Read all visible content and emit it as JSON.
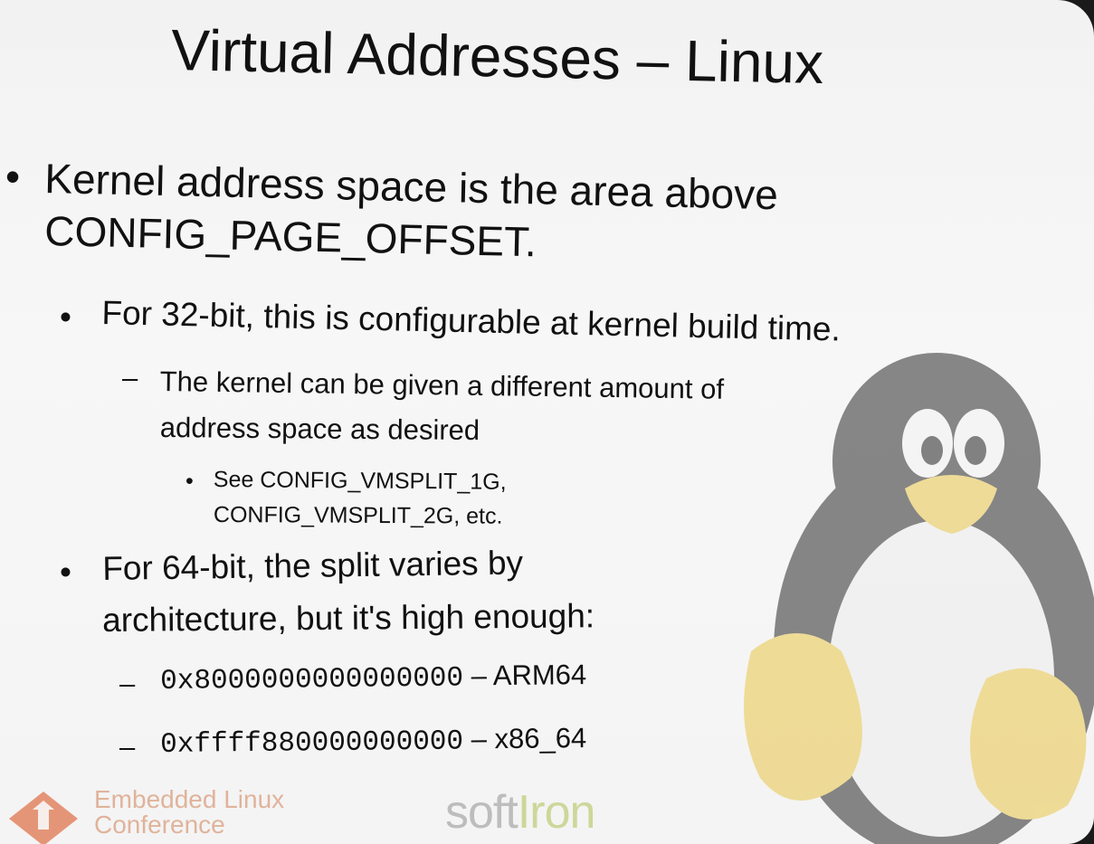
{
  "slide": {
    "title": "Virtual Addresses – Linux",
    "bullets": [
      {
        "level": 1,
        "bullet": "•",
        "text": "Kernel address space is the area above"
      },
      {
        "level": 1,
        "bullet": "",
        "text": "CONFIG_PAGE_OFFSET."
      },
      {
        "level": 2,
        "bullet": "•",
        "text": "For 32-bit, this is configurable at kernel build time."
      },
      {
        "level": 3,
        "bullet": "–",
        "text": "The kernel can be given a different amount of"
      },
      {
        "level": 3,
        "bullet": "",
        "text": "address space as desired"
      },
      {
        "level": 4,
        "bullet": "•",
        "text": "See CONFIG_VMSPLIT_1G,"
      },
      {
        "level": 4,
        "bullet": "",
        "text": "CONFIG_VMSPLIT_2G, etc."
      },
      {
        "level": 2,
        "bullet": "•",
        "text": "For 64-bit, the split varies by"
      },
      {
        "level": 2,
        "bullet": "",
        "text": "architecture, but it's high enough:"
      },
      {
        "level": 3,
        "bullet": "–",
        "code": "0x8000000000000000",
        "text": " – ARM64"
      },
      {
        "level": 3,
        "bullet": "–",
        "code": "0xffff880000000000",
        "text": " – x86_64"
      }
    ]
  },
  "footer": {
    "left_logo_line1": "Embedded Linux",
    "left_logo_line2": "Conference",
    "right_logo_soft": "soft",
    "right_logo_iron": "Iron"
  },
  "colors": {
    "text": "#111111",
    "elc_accent": "#e0764e",
    "softiron_green": "#cdd79a"
  }
}
